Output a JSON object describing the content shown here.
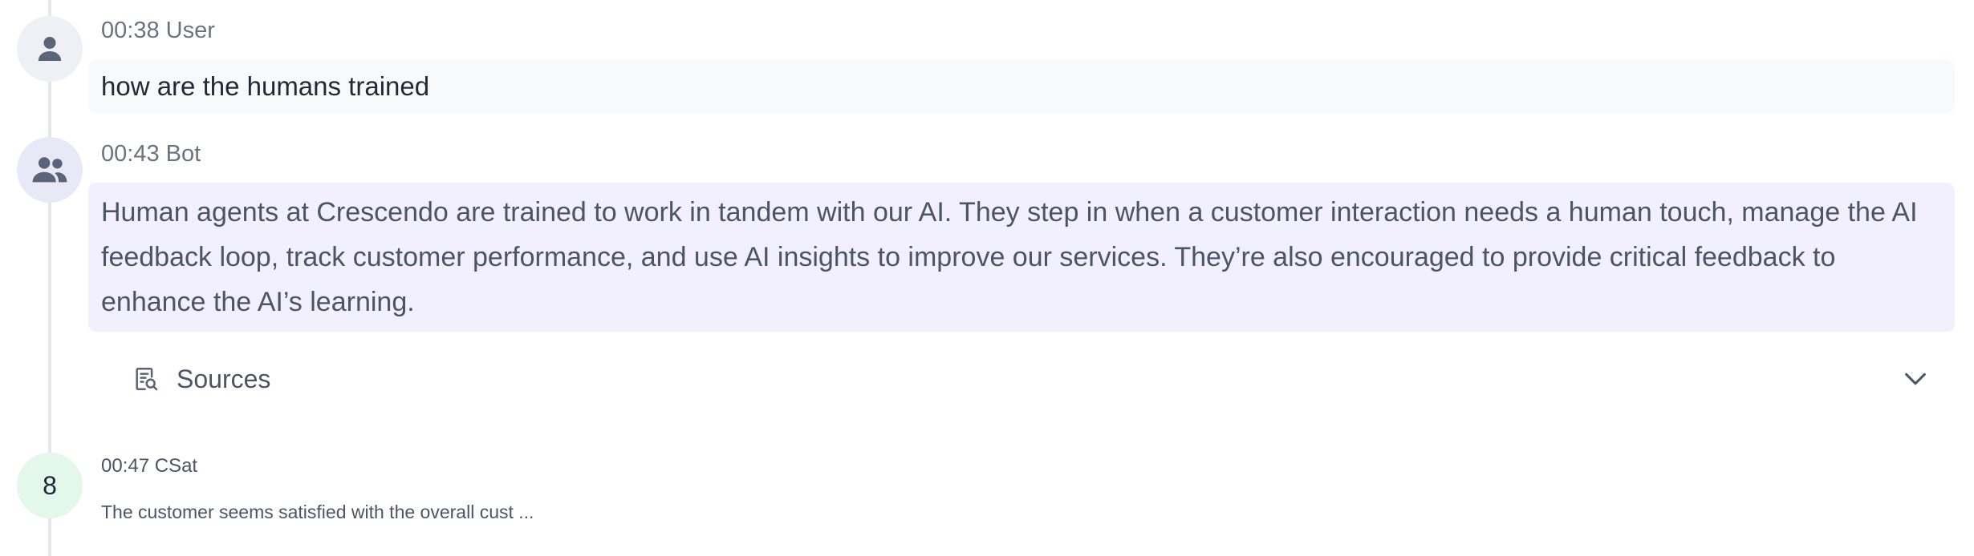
{
  "messages": {
    "user": {
      "meta": "00:38 User",
      "text": "how are the humans trained",
      "avatar_icon": "person-icon"
    },
    "bot": {
      "meta": "00:43 Bot",
      "text": "Human agents at Crescendo are trained to work in tandem with our AI. They step in when a customer interaction needs a human touch, manage the AI feedback loop, track customer performance, and use AI insights to improve our services. They’re also encouraged to provide critical feedback to enhance the AI’s learning.",
      "avatar_icon": "group-icon"
    }
  },
  "sources": {
    "label": "Sources",
    "icon": "document-search-icon",
    "toggle_icon": "chevron-down-icon"
  },
  "csat": {
    "score": "8",
    "meta": "00:47 CSat",
    "text": "The customer seems satisfied with the overall cust ..."
  },
  "colors": {
    "user_bubble": "#f8f9fb",
    "bot_bubble": "#f1f0fc",
    "csat_badge": "#e3f7ea",
    "timeline": "#e5e7eb"
  }
}
